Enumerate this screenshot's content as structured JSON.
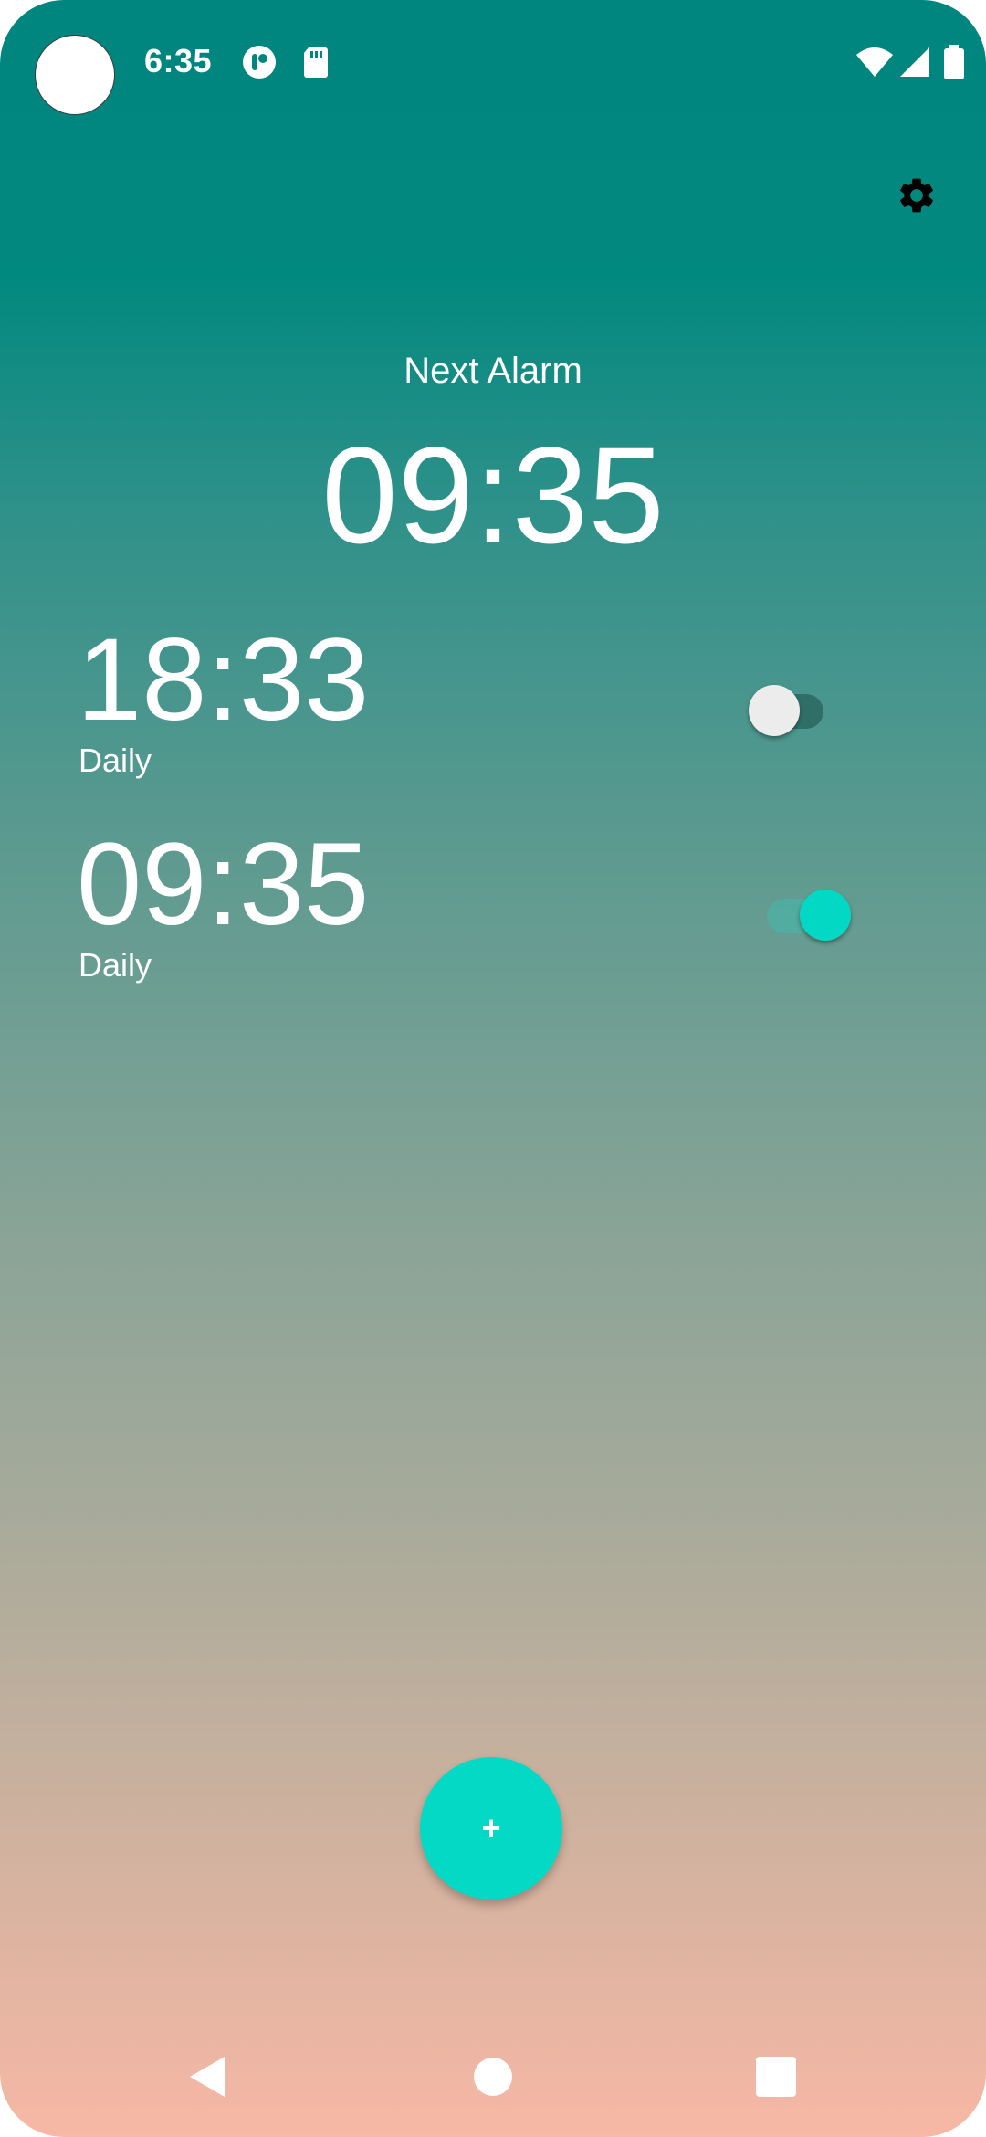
{
  "status_bar": {
    "time": "6:35",
    "icons": [
      "notification-app-icon",
      "sd-card-icon",
      "wifi-icon",
      "signal-icon",
      "battery-icon"
    ]
  },
  "header": {
    "settings_icon": "gear-icon"
  },
  "next_alarm": {
    "label": "Next Alarm",
    "time": "09:35"
  },
  "alarms": [
    {
      "time": "18:33",
      "repeat": "Daily",
      "enabled": false
    },
    {
      "time": "09:35",
      "repeat": "Daily",
      "enabled": true
    }
  ],
  "fab": {
    "label": "+"
  },
  "nav": {
    "icons": [
      "back-icon",
      "home-icon",
      "recents-icon"
    ]
  },
  "colors": {
    "gradient_top": "#00857f",
    "gradient_bottom": "#f7b8a5",
    "accent": "#03d9c5",
    "text": "#ffffff"
  }
}
